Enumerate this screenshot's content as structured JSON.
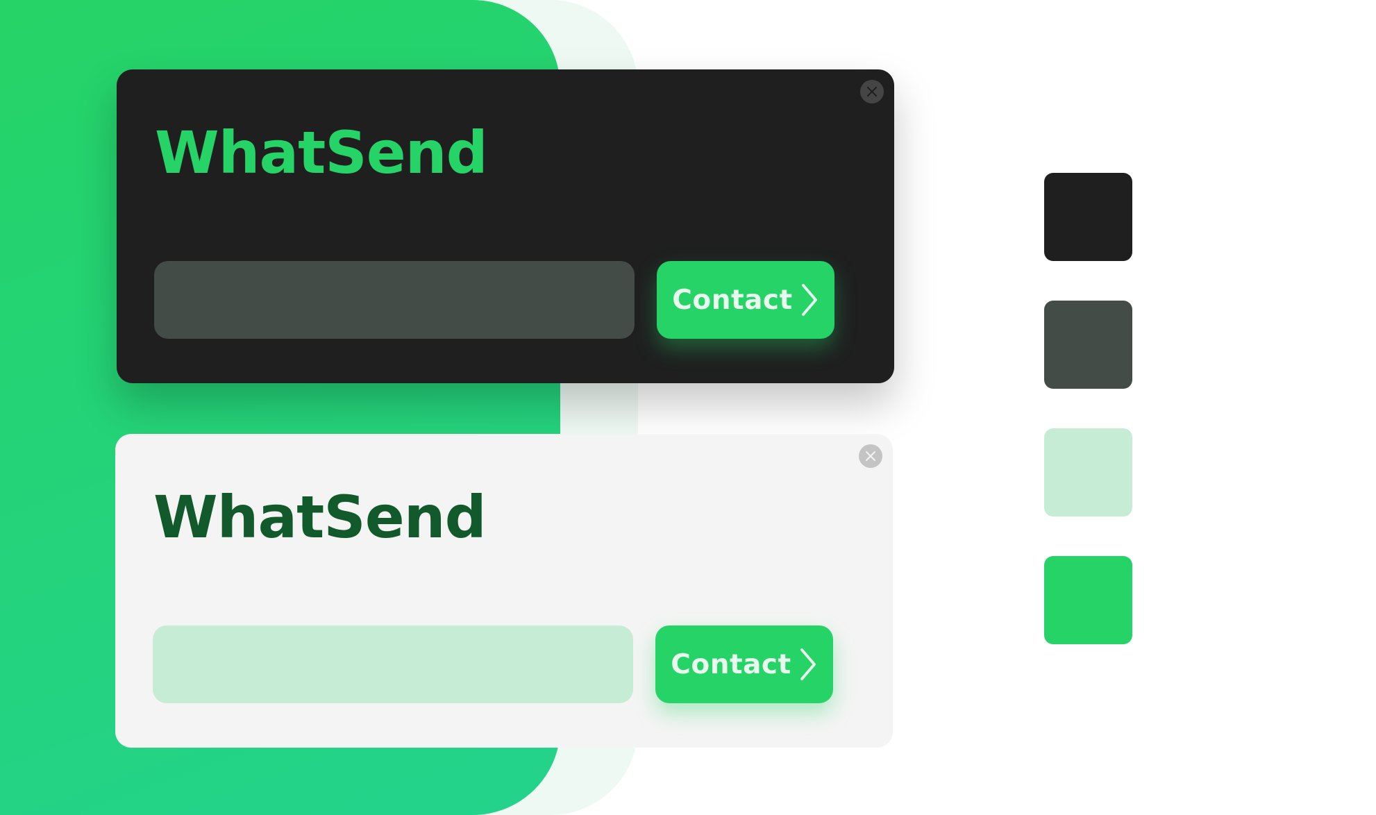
{
  "colors": {
    "dark": "#1f1f20",
    "slate": "#434c47",
    "mint": "#c6ecd5",
    "brand_green": "#25d366",
    "dark_green_text": "#125a2b",
    "light_background": "#f4f4f4"
  },
  "widgets": [
    {
      "theme": "dark",
      "title": "WhatSend",
      "input": {
        "value": "",
        "placeholder": ""
      },
      "button": {
        "label": "Contact",
        "icon": "chevron-right-icon"
      },
      "close": {
        "icon": "close-icon"
      }
    },
    {
      "theme": "light",
      "title": "WhatSend",
      "input": {
        "value": "",
        "placeholder": ""
      },
      "button": {
        "label": "Contact",
        "icon": "chevron-right-icon"
      },
      "close": {
        "icon": "close-icon"
      }
    }
  ],
  "palette": [
    "#1f1f20",
    "#434c47",
    "#c6ecd5",
    "#25d366"
  ]
}
